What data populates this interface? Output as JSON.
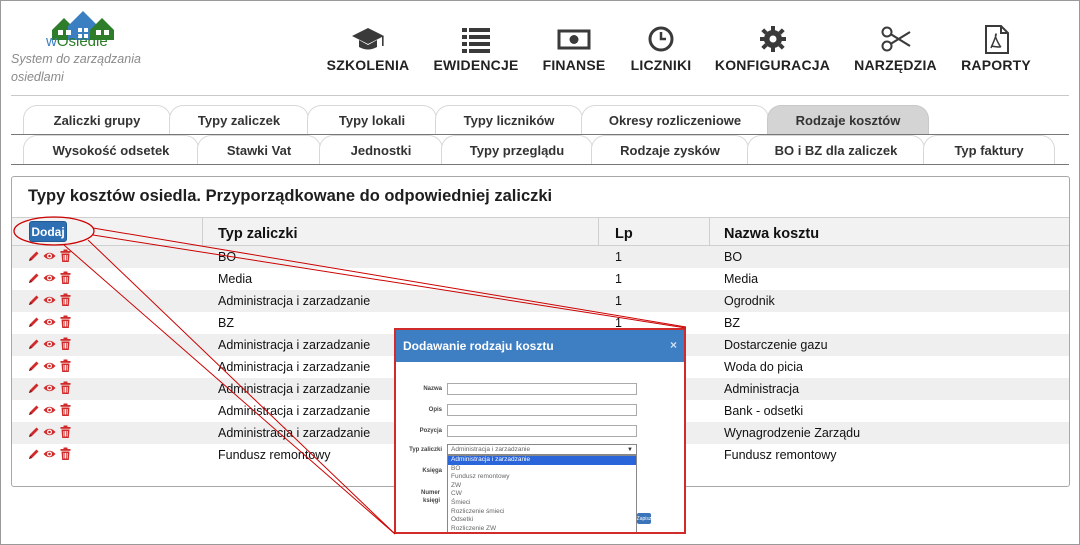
{
  "brand": {
    "logo_text_w": "w",
    "logo_text_rest": "Osiedle",
    "tagline": "System do zarządzania osiedlami"
  },
  "nav": [
    {
      "label": "SZKOLENIA",
      "icon": "graduation-cap-icon"
    },
    {
      "label": "EWIDENCJE",
      "icon": "list-icon"
    },
    {
      "label": "FINANSE",
      "icon": "money-bill-icon"
    },
    {
      "label": "LICZNIKI",
      "icon": "clock-icon"
    },
    {
      "label": "KONFIGURACJA",
      "icon": "gear-icon"
    },
    {
      "label": "NARZĘDZIA",
      "icon": "scissors-icon"
    },
    {
      "label": "RAPORTY",
      "icon": "pdf-file-icon"
    }
  ],
  "tabs_row1": [
    "Zaliczki grupy",
    "Typy zaliczek",
    "Typy lokali",
    "Typy liczników",
    "Okresy rozliczeniowe",
    "Rodzaje kosztów"
  ],
  "tabs_row2": [
    "Wysokość odsetek",
    "Stawki Vat",
    "Jednostki",
    "Typy przeglądu",
    "Rodzaje zysków",
    "BO i BZ dla zaliczek",
    "Typ faktury"
  ],
  "active_tab": "Rodzaje kosztów",
  "panel": {
    "title": "Typy kosztów osiedla. Przyporządkowane do odpowiedniej zaliczki",
    "add_button": "Dodaj",
    "columns": [
      "Typ zaliczki",
      "Lp",
      "Nazwa kosztu"
    ],
    "rows": [
      {
        "typ": "BO",
        "lp": "1",
        "nazwa": "BO"
      },
      {
        "typ": "Media",
        "lp": "1",
        "nazwa": "Media"
      },
      {
        "typ": "Administracja i zarzadzanie",
        "lp": "1",
        "nazwa": "Ogrodnik"
      },
      {
        "typ": "BZ",
        "lp": "1",
        "nazwa": "BZ"
      },
      {
        "typ": "Administracja i zarzadzanie",
        "lp": "",
        "nazwa": "Dostarczenie gazu"
      },
      {
        "typ": "Administracja i zarzadzanie",
        "lp": "",
        "nazwa": "Woda do picia"
      },
      {
        "typ": "Administracja i zarzadzanie",
        "lp": "",
        "nazwa": "Administracja"
      },
      {
        "typ": "Administracja i zarzadzanie",
        "lp": "",
        "nazwa": "Bank - odsetki"
      },
      {
        "typ": "Administracja i zarzadzanie",
        "lp": "",
        "nazwa": "Wynagrodzenie Zarządu"
      },
      {
        "typ": "Fundusz remontowy",
        "lp": "",
        "nazwa": "Fundusz remontowy"
      }
    ]
  },
  "modal": {
    "title": "Dodawanie rodzaju kosztu",
    "close": "×",
    "labels": {
      "nazwa": "Nazwa",
      "opis": "Opis",
      "pozycja": "Pozycja",
      "typ": "Typ zaliczki",
      "ksiega": "Księga",
      "numer": "Numer księgi"
    },
    "select_value": "Administracja i zarzadzanie",
    "options": [
      "Administracja i zarzadzanie",
      "BO",
      "Fundusz remontowy",
      "ZW",
      "CW",
      "Śmieci",
      "Rozliczenie śmieci",
      "Odsetki",
      "Rozliczenie ZW"
    ],
    "save_button": "Zapisz"
  },
  "colors": {
    "accent": "#2e6fb3",
    "icon_red": "#d12a2a",
    "modal_header": "#3e7ec3",
    "annotation": "#cc0000"
  }
}
